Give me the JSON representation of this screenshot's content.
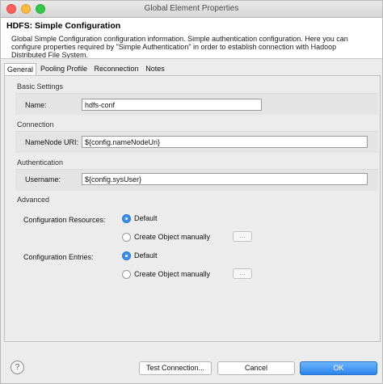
{
  "window": {
    "title": "Global Element Properties"
  },
  "header": {
    "title": "HDFS: Simple Configuration",
    "description": "Global Simple Configuration configuration information. Simple authentication configuration. Here you can configure properties required by \"Simple Authentication\" in order to establish connection with Hadoop Distributed File System."
  },
  "tabs": [
    {
      "label": "General",
      "active": true
    },
    {
      "label": "Pooling Profile",
      "active": false
    },
    {
      "label": "Reconnection",
      "active": false
    },
    {
      "label": "Notes",
      "active": false
    }
  ],
  "general": {
    "basic_settings": {
      "label": "Basic Settings",
      "name_label": "Name:",
      "name_value": "hdfs-conf"
    },
    "connection": {
      "label": "Connection",
      "uri_label": "NameNode URI:",
      "uri_value": "${config.nameNodeUri}"
    },
    "authentication": {
      "label": "Authentication",
      "username_label": "Username:",
      "username_value": "${config.sysUser}"
    },
    "advanced": {
      "label": "Advanced",
      "resources_label": "Configuration Resources:",
      "resources_options": [
        "Default",
        "Create Object manually"
      ],
      "resources_selected": "Default",
      "entries_label": "Configuration Entries:",
      "entries_options": [
        "Default",
        "Create Object manually"
      ],
      "entries_selected": "Default",
      "ellipsis": "..."
    }
  },
  "footer": {
    "help": "?",
    "test_connection": "Test Connection...",
    "cancel": "Cancel",
    "ok": "OK"
  },
  "colors": {
    "accent": "#2c84ec",
    "radio_checked": "#3d8eea"
  }
}
